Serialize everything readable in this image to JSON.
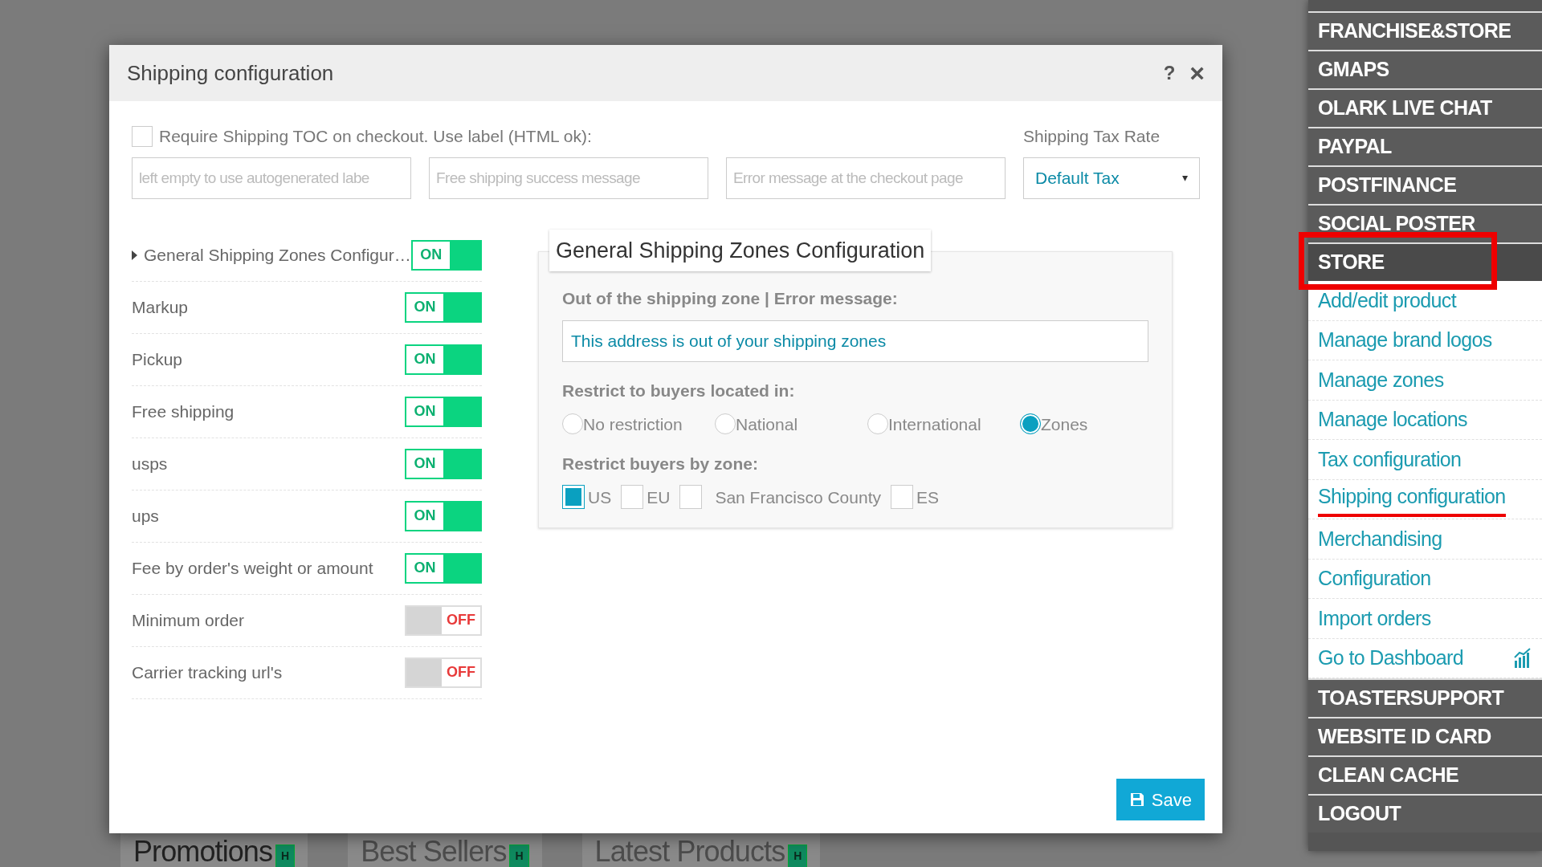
{
  "background_tabs": [
    {
      "label": "Promotions",
      "badge": "H",
      "selected": true
    },
    {
      "label": "Best Sellers",
      "badge": "H",
      "selected": false
    },
    {
      "label": "Latest Products",
      "badge": "H",
      "selected": false
    }
  ],
  "dialog": {
    "title": "Shipping configuration",
    "help": "?",
    "close": "×",
    "toc": {
      "label": "Require Shipping TOC on checkout. Use label (HTML ok):",
      "checked": false
    },
    "fields": [
      {
        "placeholder": "left empty to use autogenerated labe"
      },
      {
        "placeholder": "Free shipping success message"
      },
      {
        "placeholder": "Error message at the checkout page"
      }
    ],
    "tax": {
      "label": "Shipping Tax Rate",
      "value": "Default Tax",
      "caret": "▾"
    },
    "plugins": [
      {
        "label": "General Shipping Zones Configur…",
        "expandable": true,
        "on": true,
        "state_text": "ON"
      },
      {
        "label": "Markup",
        "expandable": false,
        "on": true,
        "state_text": "ON"
      },
      {
        "label": "Pickup",
        "expandable": false,
        "on": true,
        "state_text": "ON"
      },
      {
        "label": "Free shipping",
        "expandable": false,
        "on": true,
        "state_text": "ON"
      },
      {
        "label": "usps",
        "expandable": false,
        "on": true,
        "state_text": "ON"
      },
      {
        "label": "ups",
        "expandable": false,
        "on": true,
        "state_text": "ON"
      },
      {
        "label": "Fee by order's weight or amount",
        "expandable": false,
        "on": true,
        "state_text": "ON"
      },
      {
        "label": "Minimum order",
        "expandable": false,
        "on": false,
        "state_text": "OFF"
      },
      {
        "label": "Carrier tracking url's",
        "expandable": false,
        "on": false,
        "state_text": "OFF"
      }
    ],
    "panel": {
      "title": "General Shipping Zones Configuration",
      "error_label": "Out of the shipping zone | Error message:",
      "error_value": "This address is out of your shipping zones",
      "restrict_label": "Restrict to buyers located in:",
      "restrict_options": [
        {
          "label": "No restriction",
          "selected": false
        },
        {
          "label": "National",
          "selected": false
        },
        {
          "label": "International",
          "selected": false
        },
        {
          "label": "Zones",
          "selected": true
        }
      ],
      "zones_label": "Restrict buyers by zone:",
      "zones": [
        {
          "label": "US",
          "checked": true
        },
        {
          "label": "EU",
          "checked": false
        },
        {
          "label": "San Francisco County",
          "checked": false
        },
        {
          "label": "ES",
          "checked": false
        }
      ]
    },
    "save": "Save"
  },
  "menu": {
    "items": [
      {
        "label": "FRANCHISE&STORE",
        "expanded": false
      },
      {
        "label": "GMAPS",
        "expanded": false
      },
      {
        "label": "OLARK LIVE CHAT",
        "expanded": false
      },
      {
        "label": "PAYPAL",
        "expanded": false
      },
      {
        "label": "POSTFINANCE",
        "expanded": false
      },
      {
        "label": "SOCIAL POSTER",
        "expanded": false
      },
      {
        "label": "STORE",
        "expanded": true,
        "children": [
          {
            "label": "Add/edit product"
          },
          {
            "label": "Manage brand logos"
          },
          {
            "label": "Manage zones"
          },
          {
            "label": "Manage locations"
          },
          {
            "label": "Tax configuration"
          },
          {
            "label": "Shipping configuration",
            "highlighted": true
          },
          {
            "label": "Merchandising"
          },
          {
            "label": "Configuration"
          },
          {
            "label": "Import orders"
          },
          {
            "label": "Go to Dashboard",
            "kind": "dashboard"
          }
        ]
      },
      {
        "label": "TOASTERSUPPORT",
        "expanded": false
      },
      {
        "label": "WEBSITE ID CARD",
        "expanded": false
      },
      {
        "label": "CLEAN CACHE",
        "expanded": false
      },
      {
        "label": "LOGOUT",
        "expanded": false
      }
    ]
  }
}
